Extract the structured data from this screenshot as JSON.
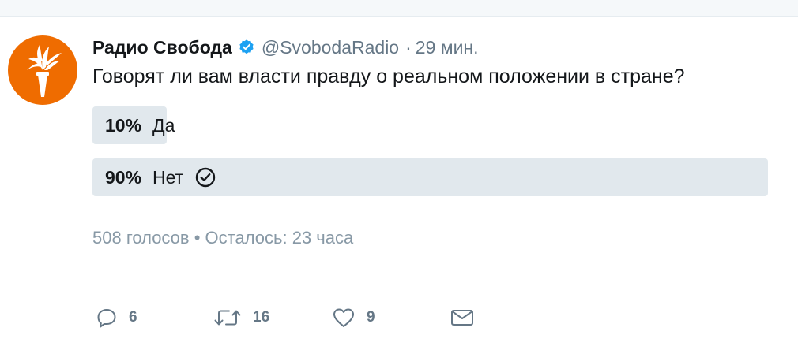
{
  "colors": {
    "brand": "#ef6c00",
    "verified": "#1da1f2",
    "poll_bar": "#e1e8ed",
    "muted": "#657786",
    "meta": "#8899a6"
  },
  "tweet": {
    "author_name": "Радио Свобода",
    "handle": "@SvobodaRadio",
    "separator": "·",
    "time": "29 мин.",
    "text": "Говорят ли вам власти правду о реальном положении в стране?",
    "avatar_icon": "svoboda-torch-logo",
    "verified_icon": "verified-badge-icon"
  },
  "poll": {
    "options": [
      {
        "percent_label": "10%",
        "percent": 10,
        "label": "Да",
        "winner": false
      },
      {
        "percent_label": "90%",
        "percent": 90,
        "label": "Нет",
        "winner": true
      }
    ],
    "meta": "508 голосов • Осталось: 23 часа"
  },
  "actions": {
    "reply": {
      "icon": "reply-icon",
      "count": "6"
    },
    "retweet": {
      "icon": "retweet-icon",
      "count": "16"
    },
    "like": {
      "icon": "heart-icon",
      "count": "9"
    },
    "dm": {
      "icon": "envelope-icon"
    }
  }
}
